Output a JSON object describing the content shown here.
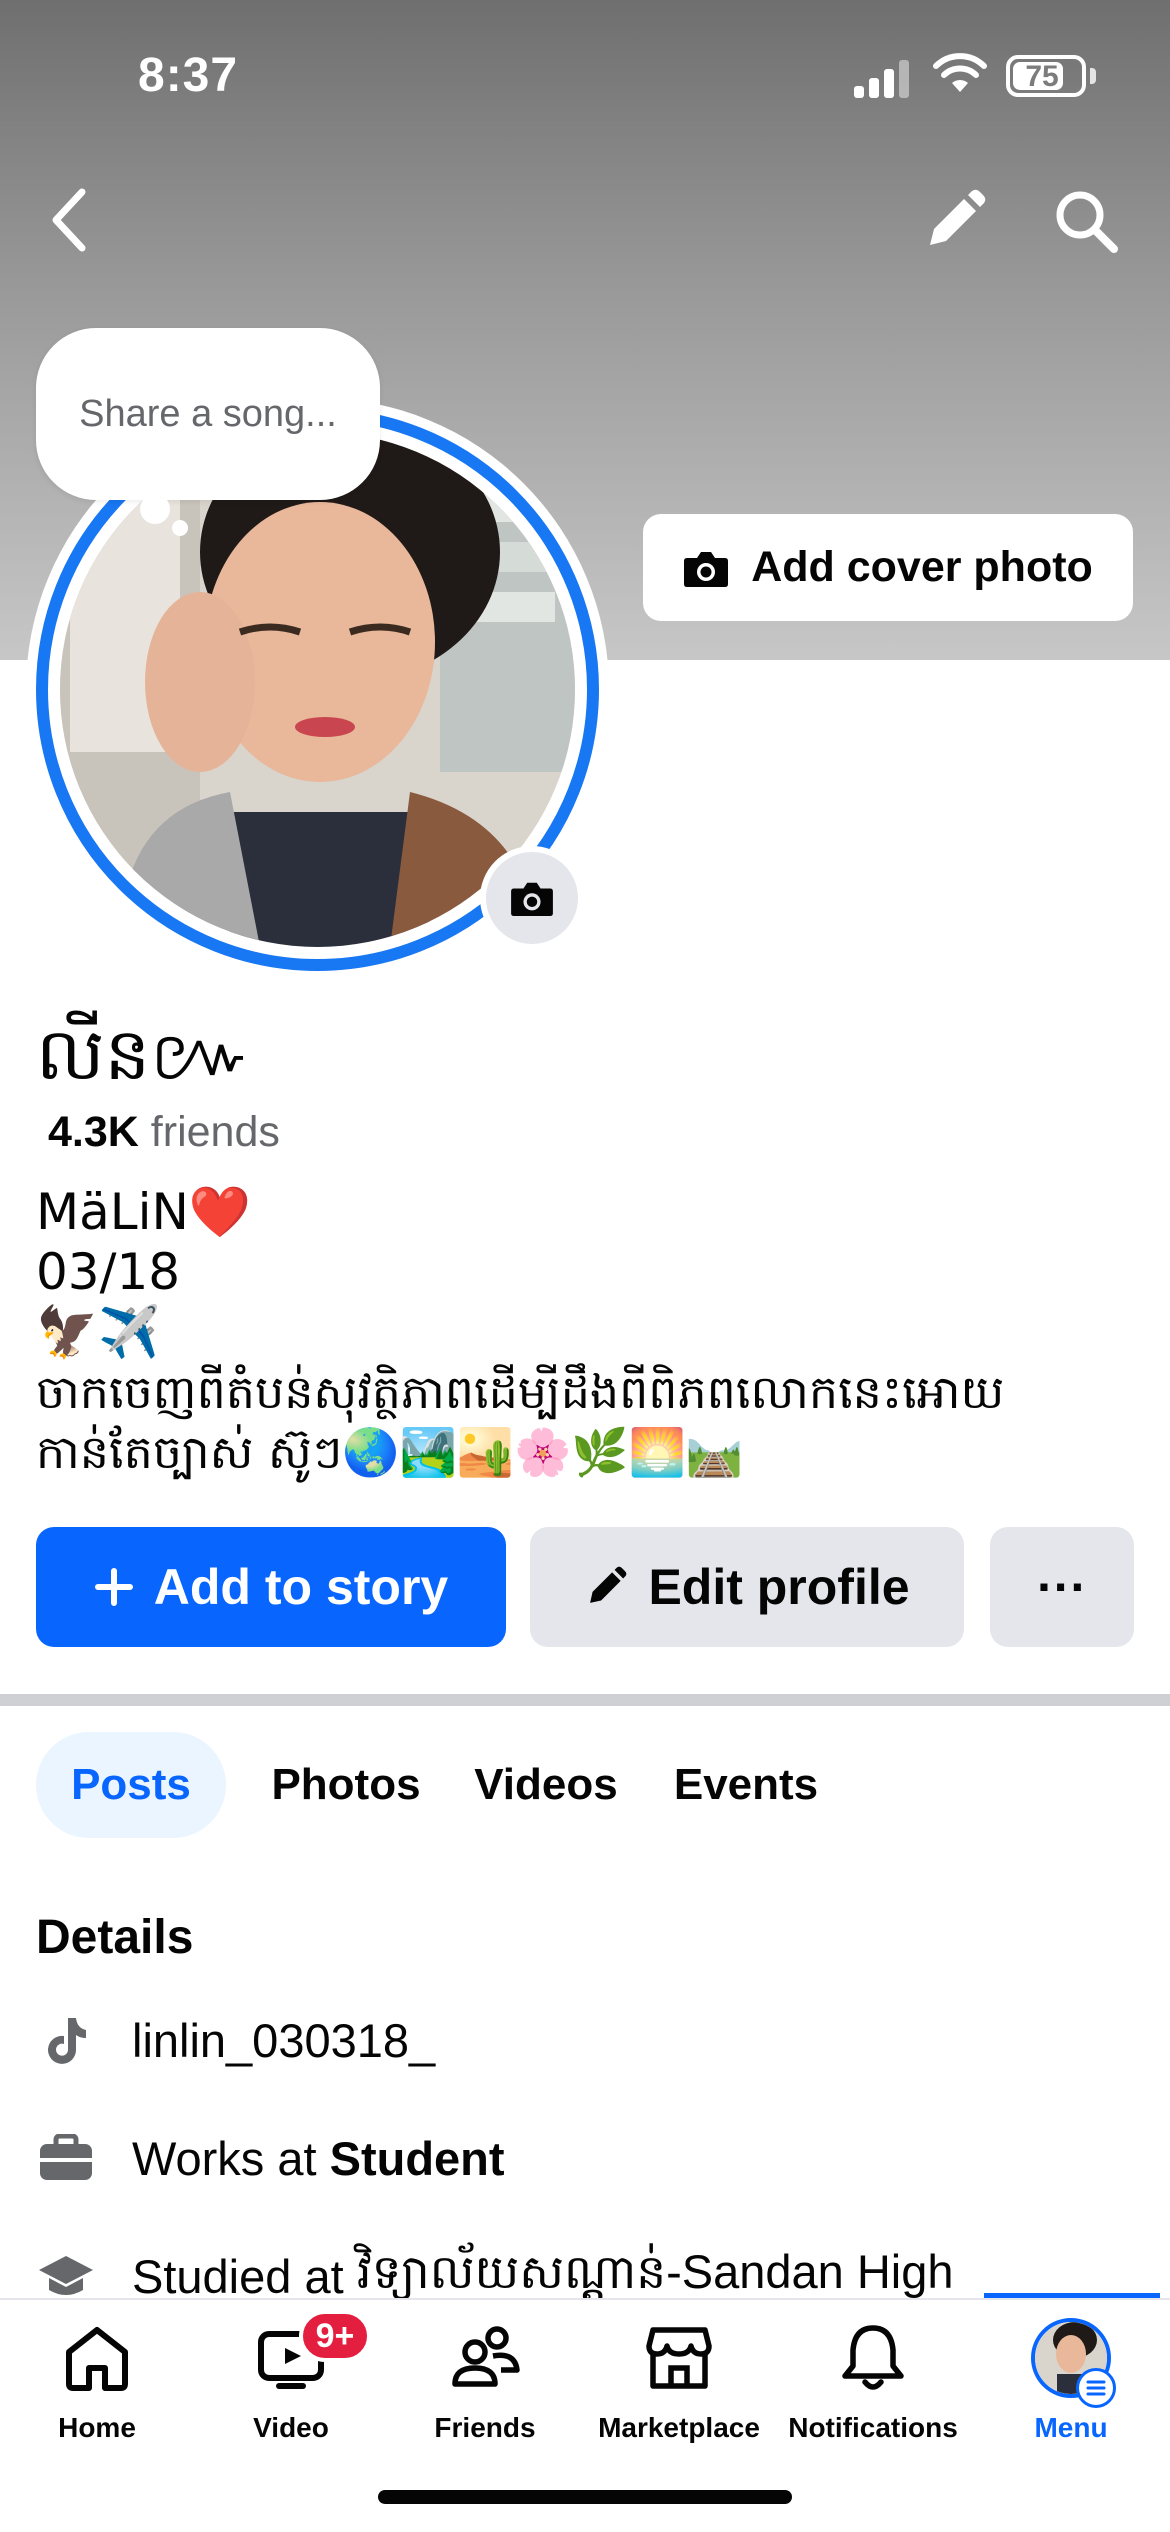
{
  "status_bar": {
    "time": "8:37",
    "battery": "75",
    "battery_level": 0.75
  },
  "header": {
    "back_icon": "chevron-left-icon",
    "edit_icon": "pencil-icon",
    "search_icon": "search-icon"
  },
  "cover": {
    "add_cover_label": "Add cover photo"
  },
  "song_bubble": {
    "placeholder": "Share a song..."
  },
  "profile": {
    "name": "លីន៚",
    "friends_count": "4.3K",
    "friends_label": "friends",
    "bio_lines": [
      "MäLiN❤️",
      "03/18",
      "🦅✈️",
      "ចាកចេញពីតំបន់សុវត្ថិភាពដើម្បីដឹងពីពិភពលោកនេះអោយ",
      "កាន់តែច្បាស់ ស៊ូៗ🌏🏞️🏜️🌸🌿🌅🛤️"
    ]
  },
  "actions": {
    "add_story": "Add to story",
    "edit_profile": "Edit profile",
    "more": "···"
  },
  "tabs": [
    "Posts",
    "Photos",
    "Videos",
    "Events"
  ],
  "details": {
    "title": "Details",
    "tiktok": "linlin_030318_",
    "work_prefix": "Works at ",
    "work_place": "Student",
    "study_prefix": "Studied at ",
    "study_place": "វិទ្យាល័យសណ្ដាន់-Sandan High"
  },
  "bottom_nav": {
    "home": "Home",
    "video": "Video",
    "video_badge": "9+",
    "friends": "Friends",
    "marketplace": "Marketplace",
    "notifications": "Notifications",
    "menu": "Menu"
  },
  "colors": {
    "accent": "#0866ff",
    "ring": "#1877f2",
    "badge": "#e41e3f",
    "secondary_text": "#65676b",
    "button_grey": "#e4e6eb"
  }
}
